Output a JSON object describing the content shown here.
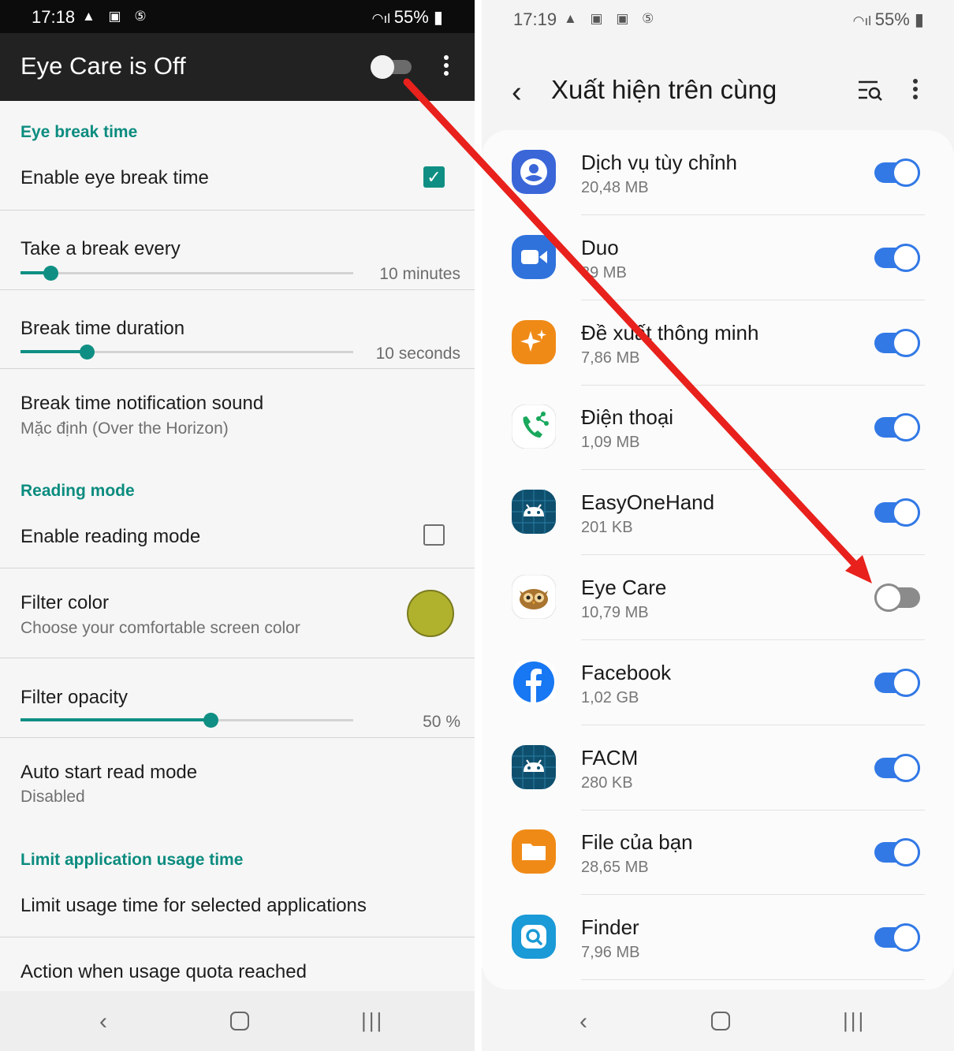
{
  "left": {
    "statusbar": {
      "time": "17:18",
      "battery": "55%"
    },
    "appbar": {
      "title": "Eye Care is Off",
      "switch_on": false
    },
    "eye_break": {
      "header": "Eye break time",
      "enable_label": "Enable eye break time",
      "enable_checked": true,
      "take_break_label": "Take a break every",
      "take_break_value": "10 minutes",
      "take_break_fraction": 0.09,
      "duration_label": "Break time duration",
      "duration_value": "10 seconds",
      "duration_fraction": 0.2,
      "sound_label": "Break time notification sound",
      "sound_value": "Mặc định (Over the Horizon)"
    },
    "reading": {
      "header": "Reading mode",
      "enable_label": "Enable reading mode",
      "enable_checked": false,
      "filter_color_label": "Filter color",
      "filter_color_sub": "Choose your comfortable screen color",
      "filter_color_hex": "#b0b22e",
      "opacity_label": "Filter opacity",
      "opacity_value": "50 %",
      "opacity_fraction": 0.57,
      "auto_start_label": "Auto start read mode",
      "auto_start_value": "Disabled"
    },
    "limit": {
      "header": "Limit application usage time",
      "limit_label": "Limit usage time for selected applications",
      "quota_label": "Action when usage quota reached"
    }
  },
  "right": {
    "statusbar": {
      "time": "17:19",
      "battery": "55%"
    },
    "title": "Xuất hiện trên cùng",
    "apps": [
      {
        "name": "Dịch vụ tùy chỉnh",
        "size": "20,48 MB",
        "enabled": true,
        "icon": "customization-service-icon",
        "color": "#3a66d8"
      },
      {
        "name": "Duo",
        "size": "39 MB",
        "enabled": true,
        "icon": "duo-video-icon",
        "color": "#2f72dc"
      },
      {
        "name": "Đề xuất thông minh",
        "size": "7,86 MB",
        "enabled": true,
        "icon": "smart-suggestions-icon",
        "color": "#f08a17"
      },
      {
        "name": "Điện thoại",
        "size": "1,09 MB",
        "enabled": true,
        "icon": "phone-icon",
        "color": "#ffffff"
      },
      {
        "name": "EasyOneHand",
        "size": "201 KB",
        "enabled": true,
        "icon": "android-icon",
        "color": "#0f4f6e"
      },
      {
        "name": "Eye Care",
        "size": "10,79 MB",
        "enabled": false,
        "icon": "owl-icon",
        "color": "#ffffff"
      },
      {
        "name": "Facebook",
        "size": "1,02 GB",
        "enabled": true,
        "icon": "facebook-icon",
        "color": "#1877f2"
      },
      {
        "name": "FACM",
        "size": "280 KB",
        "enabled": true,
        "icon": "android-icon",
        "color": "#0f4f6e"
      },
      {
        "name": "File của bạn",
        "size": "28,65 MB",
        "enabled": true,
        "icon": "folder-icon",
        "color": "#f08a17"
      },
      {
        "name": "Finder",
        "size": "7,96 MB",
        "enabled": true,
        "icon": "finder-icon",
        "color": "#1a9ad6"
      }
    ]
  },
  "colors": {
    "accent_teal": "#0f8f83",
    "toggle_blue": "#3279e6",
    "arrow_red": "#e8211c"
  }
}
